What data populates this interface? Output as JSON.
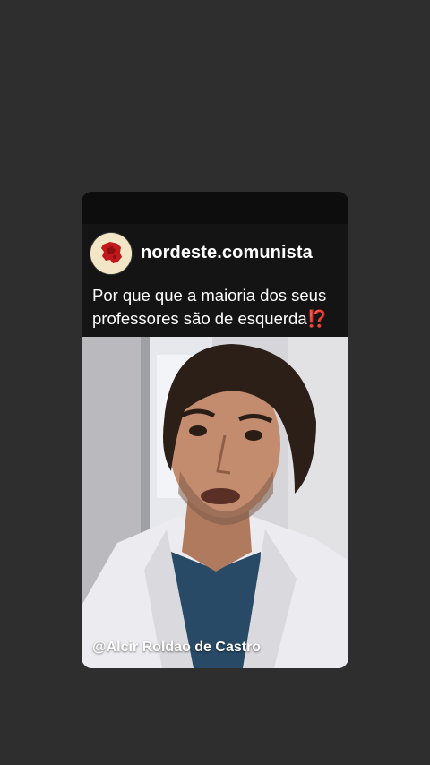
{
  "post": {
    "username": "nordeste.comunista",
    "question_text": "Por que que a maioria dos seus professores são de esquerda",
    "question_emoji": "⁉️",
    "avatar_icon": "red-map-logo-icon",
    "video_credit": "@Alcir Roldao de Castro"
  },
  "colors": {
    "background": "#2e2e2e",
    "header": "#141414",
    "accent_red": "#e0241f",
    "avatar_bg": "#f3e6c6"
  }
}
